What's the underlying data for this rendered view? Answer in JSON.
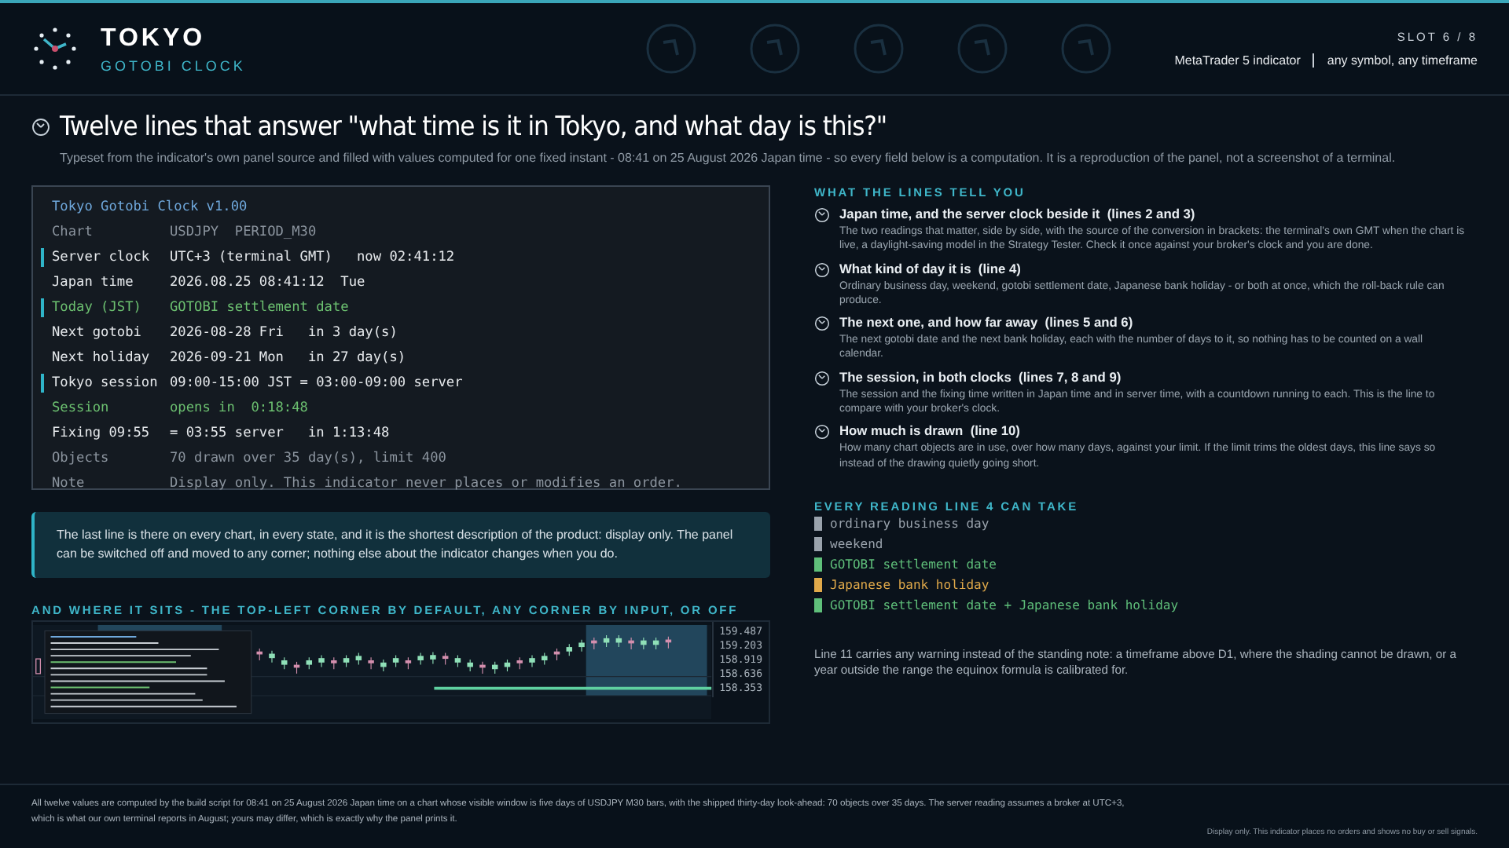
{
  "header": {
    "title": "TOKYO",
    "subtitle": "GOTOBI CLOCK",
    "slot": "SLOT 6 / 8",
    "platform": "MetaTrader 5 indicator",
    "scope": "any symbol, any timeframe"
  },
  "intro": {
    "heading": "Twelve lines that answer \"what time is it in Tokyo, and what day is this?\"",
    "text": "Typeset from the indicator's own panel source and filled with values computed for one fixed instant - 08:41 on 25 August 2026 Japan time - so every field below is a computation. It is a reproduction of the panel, not a screenshot of a terminal."
  },
  "panel": {
    "lines": [
      {
        "label": "Tokyo Gotobi Clock v1.00",
        "kind": "title",
        "marked": false
      },
      {
        "label": "Chart",
        "value": "USDJPY  PERIOD_M30",
        "kind": "muted",
        "marked": false
      },
      {
        "label": "Server clock",
        "value": "UTC+3 (terminal GMT)   now 02:41:12",
        "kind": "normal",
        "marked": true
      },
      {
        "label": "Japan time",
        "value": "2026.08.25 08:41:12  Tue",
        "kind": "normal",
        "marked": false
      },
      {
        "label": "Today (JST)",
        "value": "GOTOBI settlement date",
        "kind": "good",
        "marked": true
      },
      {
        "label": "Next gotobi",
        "value": "2026-08-28 Fri   in 3 day(s)",
        "kind": "normal",
        "marked": false
      },
      {
        "label": "Next holiday",
        "value": "2026-09-21 Mon   in 27 day(s)",
        "kind": "normal",
        "marked": false
      },
      {
        "label": "Tokyo session",
        "value": "09:00-15:00 JST = 03:00-09:00 server",
        "kind": "normal",
        "marked": true
      },
      {
        "label": "Session",
        "value": "opens in  0:18:48",
        "kind": "good",
        "marked": false
      },
      {
        "label": "Fixing 09:55",
        "value": "= 03:55 server   in 1:13:48",
        "kind": "normal",
        "marked": false
      },
      {
        "label": "Objects",
        "value": "70 drawn over 35 day(s), limit 400",
        "kind": "muted",
        "marked": false
      },
      {
        "label": "Note",
        "value": "Display only. This indicator never places or modifies an order.",
        "kind": "muted",
        "marked": false
      }
    ]
  },
  "callout": "The last line is there on every chart, in every state, and it is the shortest description of the product: display only. The panel can be switched off and moved to any corner; nothing else about the indicator changes when you do.",
  "placement": {
    "heading": "AND WHERE IT SITS - THE TOP-LEFT CORNER BY DEFAULT, ANY CORNER BY INPUT, OR OFF",
    "price_labels": [
      "159.487",
      "159.203",
      "158.919",
      "158.636",
      "158.353"
    ]
  },
  "lines_guide": {
    "heading": "WHAT THE LINES TELL YOU",
    "items": [
      {
        "title": "Japan time, and the server clock beside it",
        "ref": "(lines 2 and 3)",
        "text": "The two readings that matter, side by side, with the source of the conversion in brackets: the terminal's own GMT when the chart is live, a daylight-saving model in the Strategy Tester. Check it once against your broker's clock and you are done."
      },
      {
        "title": "What kind of day it is",
        "ref": "(line 4)",
        "text": "Ordinary business day, weekend, gotobi settlement date, Japanese bank holiday - or both at once, which the roll-back rule can produce."
      },
      {
        "title": "The next one, and how far away",
        "ref": "(lines 5 and 6)",
        "text": "The next gotobi date and the next bank holiday, each with the number of days to it, so nothing has to be counted on a wall calendar."
      },
      {
        "title": "The session, in both clocks",
        "ref": "(lines 7, 8 and 9)",
        "text": "The session and the fixing time written in Japan time and in server time, with a countdown running to each. This is the line to compare with your broker's clock."
      },
      {
        "title": "How much is drawn",
        "ref": "(line 10)",
        "text": "How many chart objects are in use, over how many days, against your limit. If the limit trims the oldest days, this line says so instead of the drawing quietly going short."
      }
    ]
  },
  "readings": {
    "heading": "EVERY READING LINE 4 CAN TAKE",
    "items": [
      {
        "label": "ordinary business day",
        "color": "#9aa3ad"
      },
      {
        "label": "weekend",
        "color": "#9aa3ad"
      },
      {
        "label": "GOTOBI settlement date",
        "color": "#5fbf7a"
      },
      {
        "label": "Japanese bank holiday",
        "color": "#e0a94a"
      },
      {
        "label": "GOTOBI settlement date + Japanese bank holiday",
        "color": "#5fbf7a"
      }
    ]
  },
  "warning_note": "Line 11 carries any warning instead of the standing note: a timeframe above D1, where the shading cannot be drawn, or a year outside the range the equinox formula is calibrated for.",
  "footer": {
    "text": "All twelve values are computed by the build script for 08:41 on 25 August 2026 Japan time on a chart whose visible window is five days of USDJPY M30 bars, with the shipped thirty-day look-ahead: 70 objects over 35 days. The server reading assumes a broker at UTC+3, which is what our own terminal reports in August; yours may differ, which is exactly why the panel prints it.",
    "disclaimer": "Display only. This indicator places no orders and shows no buy or sell signals."
  }
}
